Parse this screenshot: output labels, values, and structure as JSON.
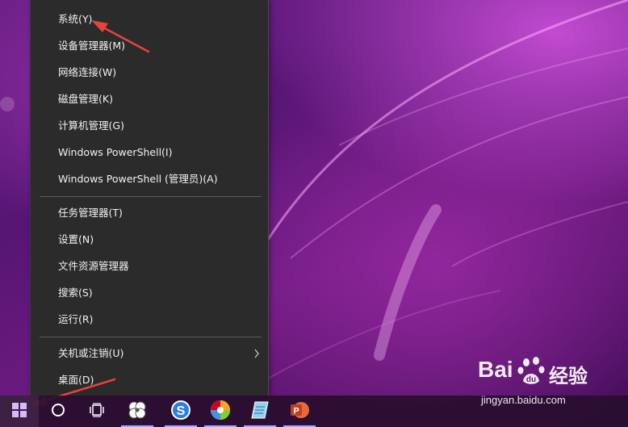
{
  "context_menu": {
    "group1": [
      {
        "label": "系统(Y)"
      },
      {
        "label": "设备管理器(M)"
      },
      {
        "label": "网络连接(W)"
      },
      {
        "label": "磁盘管理(K)"
      },
      {
        "label": "计算机管理(G)"
      },
      {
        "label": "Windows PowerShell(I)"
      },
      {
        "label": "Windows PowerShell (管理员)(A)"
      }
    ],
    "group2": [
      {
        "label": "任务管理器(T)"
      },
      {
        "label": "设置(N)"
      },
      {
        "label": "文件资源管理器"
      },
      {
        "label": "搜索(S)"
      },
      {
        "label": "运行(R)"
      }
    ],
    "group3": [
      {
        "label": "关机或注销(U)",
        "has_submenu": true,
        "icon": "chevron-right-icon"
      },
      {
        "label": "桌面(D)"
      }
    ]
  },
  "taskbar": {
    "buttons": [
      {
        "icon": "windows-start-icon",
        "active": true
      },
      {
        "icon": "cortana-circle-icon"
      },
      {
        "icon": "task-view-icon"
      },
      {
        "icon": "pinwheel-app-icon",
        "running": true
      },
      {
        "icon": "sogou-s-icon",
        "running": true
      },
      {
        "icon": "color-wheel-app-icon",
        "running": true
      },
      {
        "icon": "notepad-app-icon",
        "running": true
      },
      {
        "icon": "powerpoint-icon",
        "running": true
      }
    ]
  },
  "watermark": {
    "brand": "Bai",
    "brand_suffix": "经验",
    "url": "jingyan.baidu.com"
  },
  "colors": {
    "menu_bg": "#2b2b2b",
    "menu_text": "#f2f2f2",
    "arrow_red": "#e8433a",
    "taskbar_accent": "#a9a9ff"
  }
}
